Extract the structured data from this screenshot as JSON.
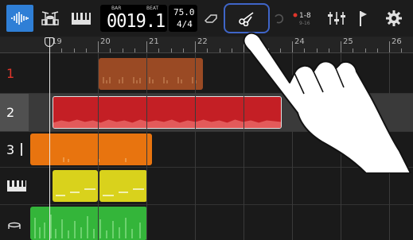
{
  "toolbar": {
    "buttons": [
      {
        "name": "waveform-mode-icon"
      },
      {
        "name": "drum-mode-icon"
      },
      {
        "name": "keyboard-mode-icon"
      }
    ],
    "counter": {
      "bar_label": "BAR",
      "beat_label": "BEAT",
      "value": "0019.1"
    },
    "tempo": {
      "bpm": "75.0",
      "time_signature": "4/4"
    },
    "accent": "#2f7fd6",
    "highlight": "#3f65c8"
  },
  "track_select": {
    "top": "1-8",
    "bottom": "9-16"
  },
  "ruler": {
    "bars": [
      "19",
      "20",
      "21",
      "22",
      "23",
      "24",
      "25",
      "26"
    ]
  },
  "tracks": [
    {
      "label": "1",
      "label_color": "#e0352b",
      "region_color": "#9a4a24"
    },
    {
      "label": "2",
      "label_color": "#ffffff",
      "region_color": "#c41f25",
      "selected": true
    },
    {
      "label": "3",
      "label_color": "#ffffff",
      "region_color": "#e8740f"
    },
    {
      "label": "",
      "icon": "piano-icon",
      "region_color": "#d9d21c"
    },
    {
      "label": "",
      "icon": "drum-icon",
      "region_color": "#34b53a"
    }
  ]
}
